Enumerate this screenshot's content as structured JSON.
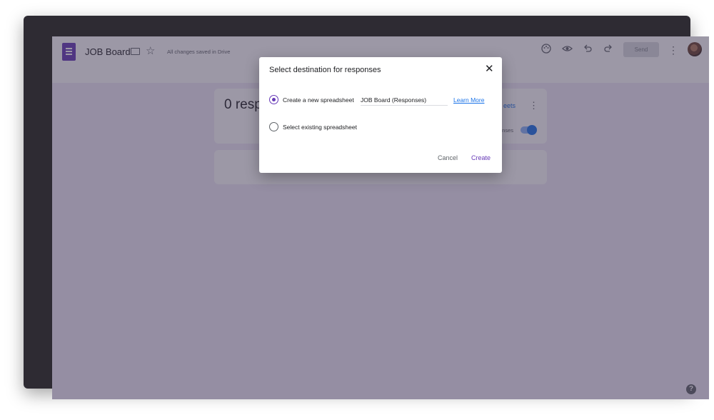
{
  "header": {
    "doc_title": "JOB Board",
    "save_status": "All changes saved in Drive",
    "send_label": "Send",
    "icons": [
      "forms-logo-icon",
      "folder-icon",
      "star-icon",
      "palette-icon",
      "preview-eye-icon",
      "undo-icon",
      "redo-icon",
      "more-vert-icon",
      "avatar"
    ]
  },
  "responses_card": {
    "count_text": "0 resp",
    "sheets_link": "eets",
    "accepting_label": "nses"
  },
  "dialog": {
    "title": "Select destination for responses",
    "option_new": "Create a new spreadsheet",
    "spreadsheet_name": "JOB Board (Responses)",
    "learn_more": "Learn More",
    "option_existing": "Select existing spreadsheet",
    "cancel_label": "Cancel",
    "create_label": "Create",
    "selected_option": "new"
  },
  "colors": {
    "accent": "#673ab7",
    "link": "#1a73e8",
    "background": "#f0ebf8"
  }
}
